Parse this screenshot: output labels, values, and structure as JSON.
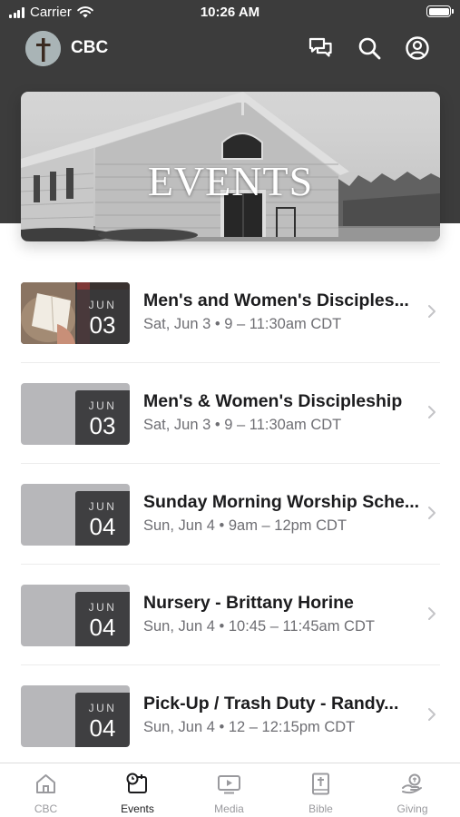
{
  "status_bar": {
    "carrier": "Carrier",
    "time": "10:26 AM"
  },
  "header": {
    "org_name": "CBC"
  },
  "hero": {
    "title": "EVENTS"
  },
  "events": [
    {
      "month": "JUN",
      "day": "03",
      "title": "Men's and Women's Disciples...",
      "meta": "Sat, Jun 3 • 9 – 11:30am CDT"
    },
    {
      "month": "JUN",
      "day": "03",
      "title": "Men's & Women's Discipleship",
      "meta": "Sat, Jun 3 • 9 – 11:30am CDT"
    },
    {
      "month": "JUN",
      "day": "04",
      "title": "Sunday Morning Worship Sche...",
      "meta": "Sun, Jun 4 • 9am – 12pm CDT"
    },
    {
      "month": "JUN",
      "day": "04",
      "title": "Nursery - Brittany Horine",
      "meta": "Sun, Jun 4 • 10:45 – 11:45am CDT"
    },
    {
      "month": "JUN",
      "day": "04",
      "title": "Pick-Up / Trash Duty - Randy...",
      "meta": "Sun, Jun 4 • 12 – 12:15pm CDT"
    }
  ],
  "tabs": [
    {
      "label": "CBC",
      "icon": "home-icon"
    },
    {
      "label": "Events",
      "icon": "calendar-clock-icon",
      "active": true
    },
    {
      "label": "Media",
      "icon": "media-play-icon"
    },
    {
      "label": "Bible",
      "icon": "bible-icon"
    },
    {
      "label": "Giving",
      "icon": "giving-hand-icon"
    }
  ],
  "colors": {
    "header_bg": "#3c3c3c",
    "badge_bg": "#3f3f41",
    "thumb_placeholder": "#b7b7ba",
    "tab_inactive": "#9a9a9e"
  }
}
